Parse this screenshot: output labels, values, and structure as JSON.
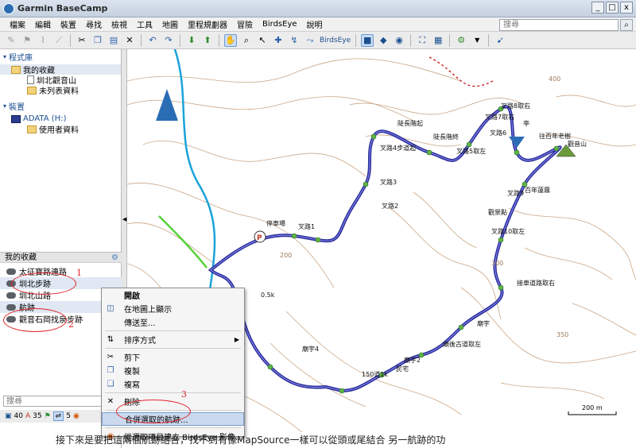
{
  "window": {
    "title": "Garmin BaseCamp",
    "btn_min": "_",
    "btn_max": "□",
    "btn_close": "x"
  },
  "menu": [
    "檔案",
    "編輯",
    "裝置",
    "尋找",
    "檢視",
    "工具",
    "地圖",
    "里程規劃器",
    "冒險",
    "BirdsEye",
    "說明"
  ],
  "search": {
    "placeholder": "搜尋",
    "button": "⌕"
  },
  "left": {
    "library_header": "程式庫",
    "my_collection": "我的收藏",
    "tree": [
      "圳北觀音山",
      "未列表資料"
    ],
    "devices_header": "裝置",
    "device": "ADATA (H:)",
    "device_folder": "使用者資料"
  },
  "favorites": {
    "header": "我的收藏",
    "items": [
      "太征寶路連路",
      "圳北步跡",
      "圳北山路",
      "航跡",
      "觀音石岡找泉步跡"
    ]
  },
  "left_search": {
    "placeholder": "搜尋"
  },
  "bottom_counts": [
    "40",
    "35",
    "5"
  ],
  "context_menu": {
    "items": [
      "開啟",
      "在地圖上顯示",
      "傳送至...",
      "排序方式",
      "剪下",
      "複製",
      "複寫",
      "刪除",
      "合併選取的航跡...",
      "從選取項目建立 BirdsEye 影像..."
    ]
  },
  "annotations": [
    "1",
    "2",
    "3"
  ],
  "map_labels": [
    "叉路1",
    "叉路2",
    "叉路3",
    "叉路4步道起",
    "陡長階起",
    "陡長階終",
    "叉路5取左",
    "叉路6",
    "叉路7取右",
    "叉路8取右",
    "觀音山",
    "往百年老樹",
    "叉路9",
    "百年蓮霧",
    "觀景點",
    "叉路10取左",
    "接車道路取右",
    "廟宇",
    "廟後古道取左",
    "廟宇2",
    "民宅",
    "150道1k",
    "廟宇4",
    "停車場",
    "0.5k",
    "200",
    "300",
    "350",
    "400",
    "200 m",
    "亭"
  ],
  "caption": "接下來是要把這兩個航跡結合，找不到有像MapSource一樣可以從頭或尾結合 另一航跡的功",
  "colors": {
    "track": "#2b2d9a",
    "river": "#1aa3d8",
    "alt_path": "#58d23a",
    "annotation": "#e0242b",
    "contour": "#c9a27c"
  }
}
